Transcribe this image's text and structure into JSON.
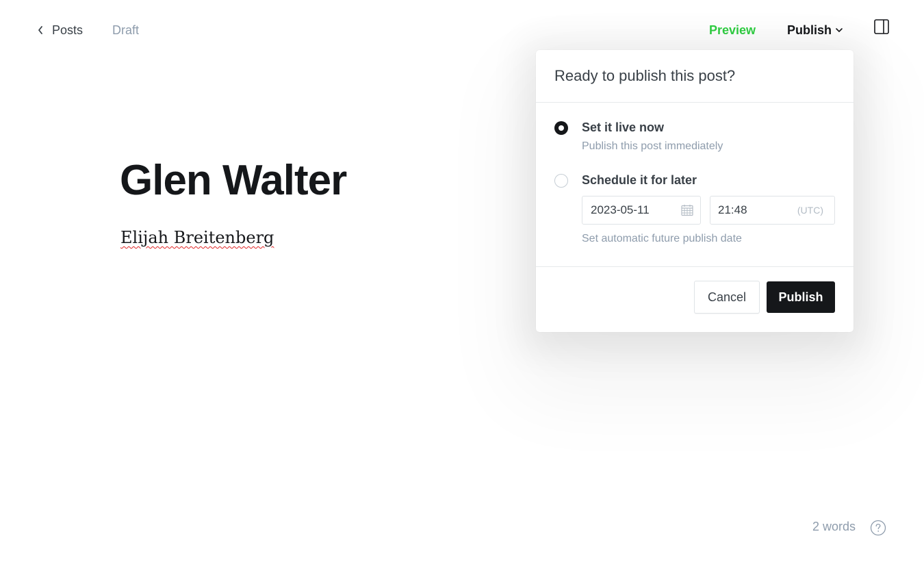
{
  "topbar": {
    "back_label": "Posts",
    "status": "Draft",
    "preview_label": "Preview",
    "publish_label": "Publish"
  },
  "editor": {
    "title": "Glen Walter",
    "body": "Elijah Breitenberg"
  },
  "publish_menu": {
    "heading": "Ready to publish this post?",
    "option_now": {
      "label": "Set it live now",
      "description": "Publish this post immediately",
      "selected": true
    },
    "option_later": {
      "label": "Schedule it for later",
      "selected": false,
      "date": "2023-05-11",
      "time": "21:48",
      "timezone": "(UTC)",
      "hint": "Set automatic future publish date"
    },
    "cancel_label": "Cancel",
    "publish_label": "Publish"
  },
  "footer": {
    "word_count": "2 words"
  },
  "colors": {
    "accent_green": "#30cf43",
    "primary_dark": "#15171a",
    "muted_text": "#8e9cac"
  }
}
